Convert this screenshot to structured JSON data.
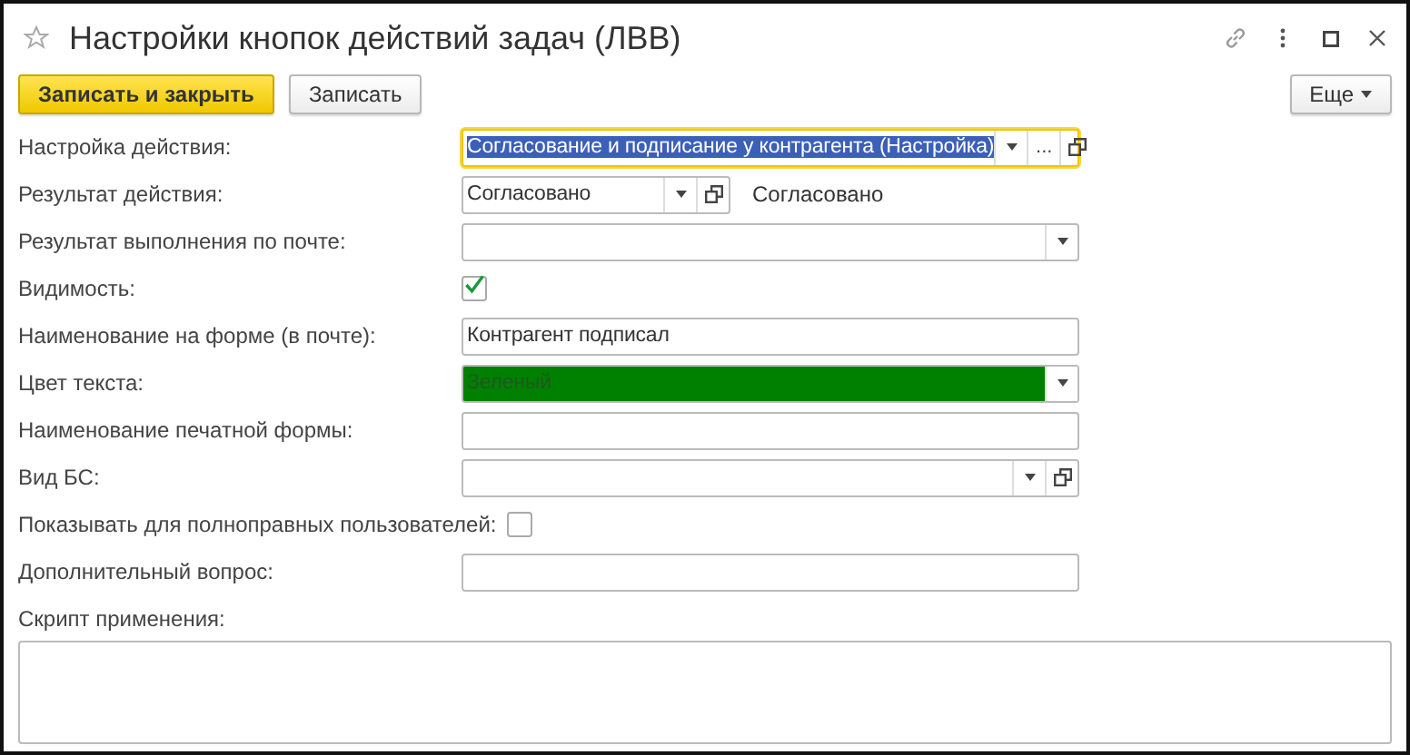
{
  "window": {
    "title": "Настройки кнопок действий задач (ЛВВ)",
    "favorite": false
  },
  "toolbar": {
    "buttons": [
      {
        "label": "Записать и закрыть",
        "kind": "primary"
      },
      {
        "label": "Записать",
        "kind": "normal"
      }
    ],
    "more": "Еще"
  },
  "fields": [
    {
      "kind": "input",
      "label": "Настройка действия:",
      "value": "Согласование и подписание у контрагента (Настройка)",
      "focused": true,
      "text_selected": true,
      "buttons": [
        {
          "kind": "dropdown"
        },
        {
          "kind": "choice",
          "text": "..."
        },
        {
          "kind": "open"
        }
      ]
    },
    {
      "kind": "input",
      "label": "Результат действия:",
      "value": "Согласовано",
      "focused": false,
      "buttons": [
        {
          "kind": "dropdown"
        },
        {
          "kind": "open"
        }
      ],
      "note": "Согласовано"
    },
    {
      "kind": "input",
      "label": "Результат выполнения по почте:",
      "focused": false,
      "buttons": [
        {
          "kind": "dropdown"
        }
      ]
    },
    {
      "kind": "checkbox",
      "label": "Видимость:",
      "checked": true
    },
    {
      "kind": "input",
      "label": "Наименование на форме (в почте):",
      "value": "Контрагент подписал",
      "focused": false
    },
    {
      "kind": "input",
      "label": "Цвет текста:",
      "value": "Зеленый",
      "color": "#008000",
      "focused": false,
      "buttons": [
        {
          "kind": "dropdown"
        }
      ]
    },
    {
      "kind": "input",
      "label": "Наименование печатной формы:",
      "focused": false
    },
    {
      "kind": "input",
      "label": "Вид БС:",
      "focused": false,
      "buttons": [
        {
          "kind": "dropdown"
        },
        {
          "kind": "open"
        }
      ]
    },
    {
      "kind": "checkbox",
      "label": "Показывать для полноправных пользователей:",
      "checked": false
    },
    {
      "kind": "input",
      "label": "Дополнительный вопрос:",
      "focused": false
    },
    {
      "kind": "textarea",
      "label": "Скрипт применения:"
    }
  ]
}
